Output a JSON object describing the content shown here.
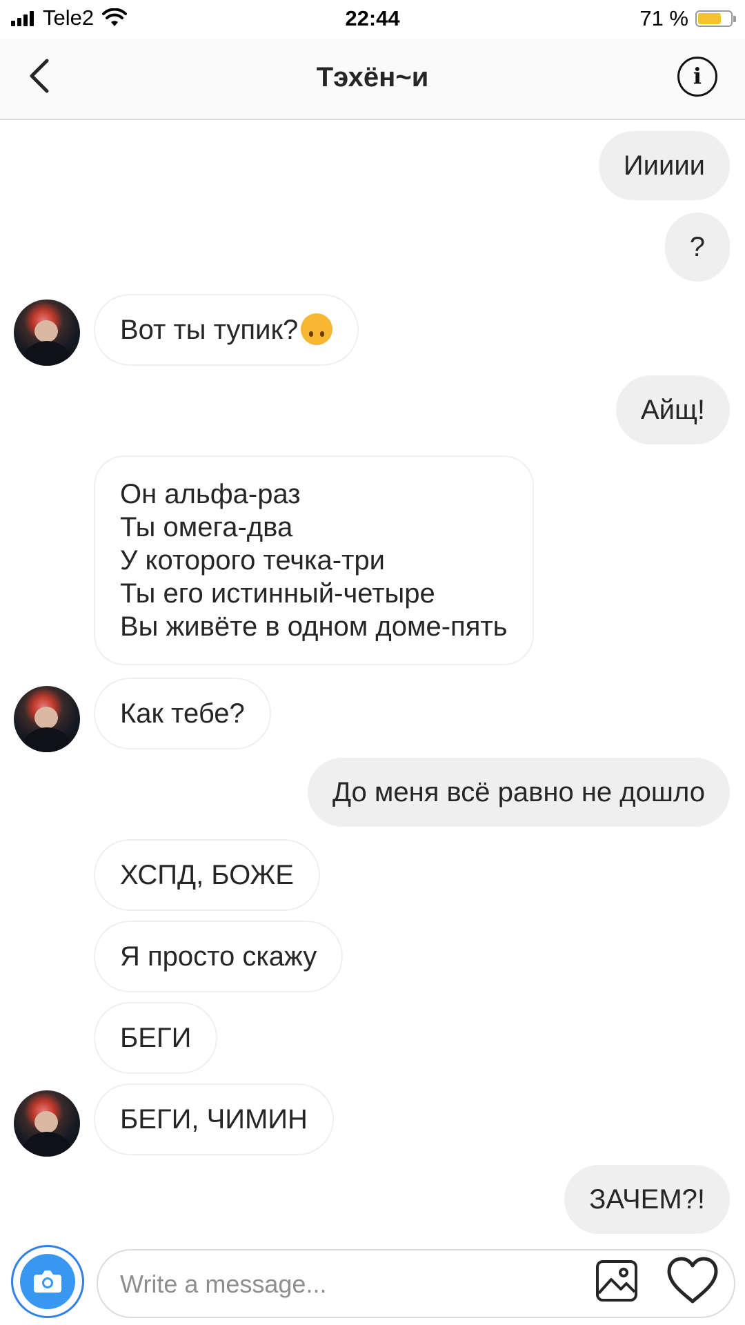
{
  "status_bar": {
    "carrier": "Tele2",
    "time": "22:44",
    "battery": "71 %",
    "battery_level": 0.71
  },
  "header": {
    "title": "Тэхён~и",
    "back_icon": "chevron-left-icon",
    "info_icon": "info-icon",
    "info_glyph": "i"
  },
  "messages": [
    {
      "side": "sent",
      "text": "Иииии"
    },
    {
      "side": "sent",
      "text": "?"
    },
    {
      "side": "received",
      "text": "Вот ты тупик?",
      "emoji": "upside-down-face"
    },
    {
      "side": "sent",
      "text": "Айщ!"
    },
    {
      "side": "received",
      "text": "Он альфа-раз\nТы омега-два\nУ которого течка-три\nТы его истинный-четыре\nВы живёте в одном доме-пять"
    },
    {
      "side": "received",
      "text": "Как тебе?"
    },
    {
      "side": "sent",
      "text": "До меня всё равно не дошло"
    },
    {
      "side": "received",
      "text": "ХСПД, БОЖЕ"
    },
    {
      "side": "received",
      "text": "Я просто скажу"
    },
    {
      "side": "received",
      "text": "БЕГИ"
    },
    {
      "side": "received",
      "text": "БЕГИ, ЧИМИН"
    },
    {
      "side": "sent",
      "text": "ЗАЧЕМ?!"
    }
  ],
  "composer": {
    "placeholder": "Write a message...",
    "camera_icon": "camera-icon",
    "gallery_icon": "gallery-icon",
    "heart_icon": "heart-icon"
  },
  "colors": {
    "sent_bubble": "#efefef",
    "received_border": "#efefef",
    "camera_accent": "#3897f0",
    "battery_fill": "#f4c430"
  }
}
